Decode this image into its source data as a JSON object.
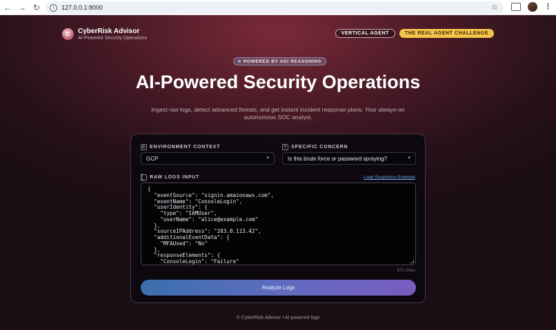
{
  "browser": {
    "url": "127.0.0.1:8000",
    "back_icon": "arrow-left",
    "forward_icon": "arrow-right",
    "reload_icon": "reload",
    "star_icon": "star",
    "menu_icon": "kebab"
  },
  "header": {
    "brand_title": "CyberRisk Advisor",
    "brand_subtitle": "AI-Powered Security Operations",
    "logo_letter": "C",
    "nav": {
      "vertical_agent": "VERTICAL AGENT",
      "challenge": "THE REAL AGENT CHALLENGE"
    }
  },
  "hero": {
    "badge": "POWERED BY AGI REASONING",
    "title": "AI-Powered Security Operations",
    "subtitle": "Ingest raw logs, detect advanced threats, and get instant incident response plans. Your always-on autonomous SOC analyst."
  },
  "form": {
    "environment": {
      "label": "ENVIRONMENT CONTEXT",
      "icon_glyph": "⚙",
      "selected": "GCP"
    },
    "concern": {
      "label": "SPECIFIC CONCERN",
      "icon_glyph": "?",
      "selected": "Is this brute force or password spraying?"
    },
    "logs": {
      "label": "RAW LOGS INPUT",
      "icon_glyph": "{ }",
      "load_example": "Load Suspicious Example",
      "content": "{\n  \"eventSource\": \"signin.amazonaws.com\",\n  \"eventName\": \"ConsoleLogin\",\n  \"userIdentity\": {\n    \"type\": \"IAMUser\",\n    \"userName\": \"alice@example.com\"\n  },\n  \"sourceIPAddress\": \"203.0.113.42\",\n  \"additionalEventData\": {\n    \"MFAUsed\": \"No\"\n  },\n  \"responseElements\": {\n    \"ConsoleLogin\": \"Failure\"",
      "char_count": "571 chars"
    },
    "submit_label": "Analyze Logs"
  },
  "footer": {
    "text": "© CyberRisk Advisor • AI powered logs"
  },
  "colors": {
    "accent_gold": "#f4c44a",
    "button_start": "#3b6fae",
    "button_end": "#7a5cc0",
    "link": "#6fb0f0"
  }
}
